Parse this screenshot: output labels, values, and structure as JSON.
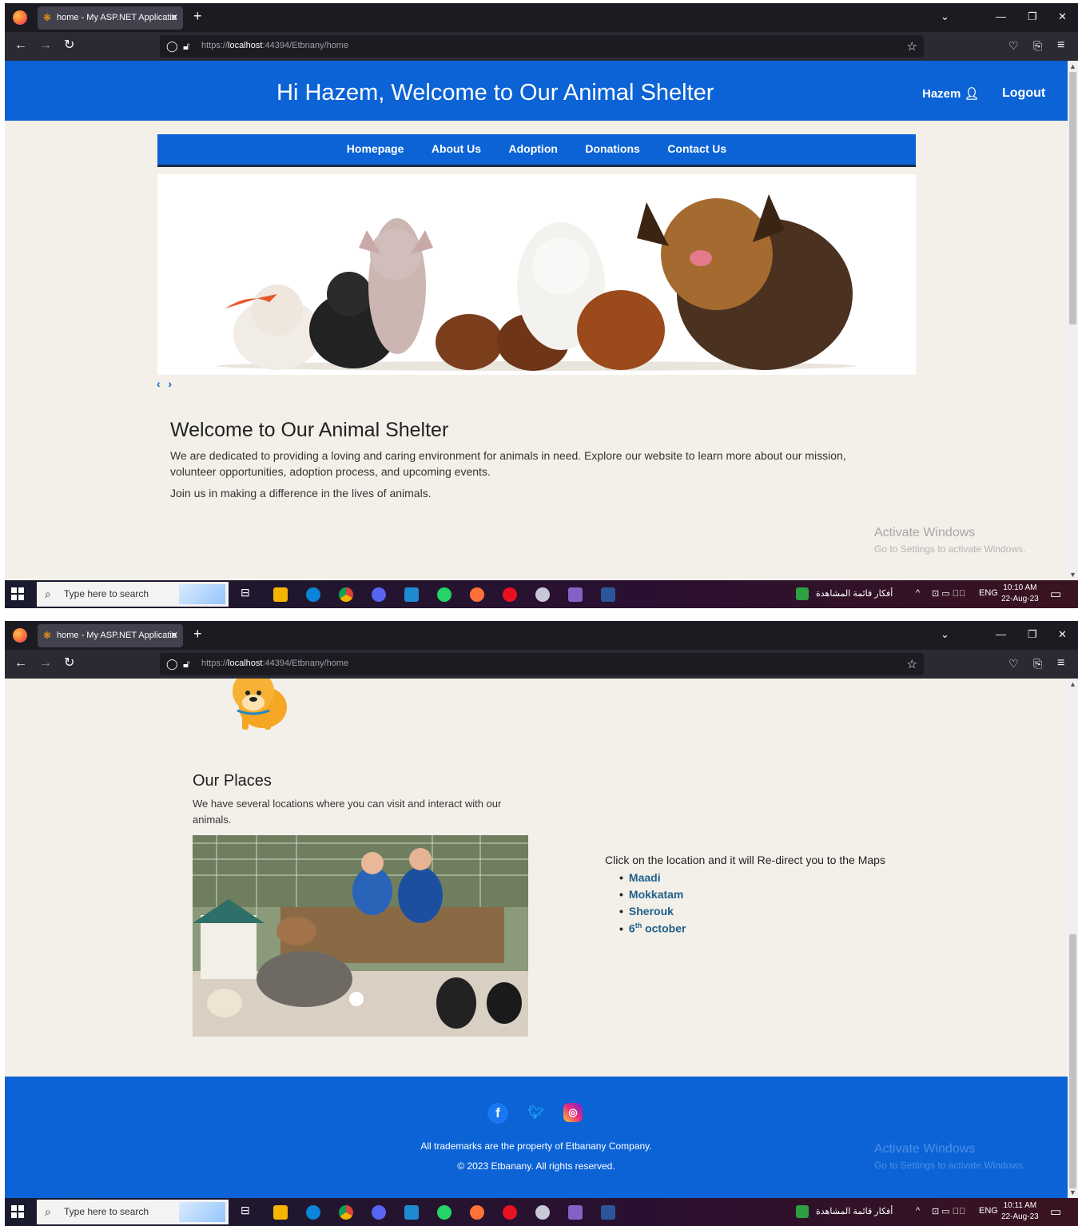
{
  "browser": {
    "tab_title": "home - My ASP.NET Applicatio",
    "new_tab": "+",
    "url_scheme": "https://",
    "url_host": "localhost",
    "url_rest": ":44394/Etbnany/home"
  },
  "site": {
    "header_title": "Hi Hazem, Welcome to Our Animal Shelter",
    "user_name": "Hazem",
    "logout_label": "Logout",
    "nav": [
      "Homepage",
      "About Us",
      "Adoption",
      "Donations",
      "Contact Us"
    ],
    "carousel_controls": "‹ ›",
    "welcome_title": "Welcome to Our Animal Shelter",
    "welcome_text": "We are dedicated to providing a loving and caring environment for animals in need. Explore our website to learn more about our mission, volunteer opportunities, adoption process, and upcoming events.",
    "join_text": "Join us in making a difference in the lives of animals.",
    "places_title": "Our Places",
    "places_text": "We have several locations where you can visit and interact with our animals.",
    "locations_intro": "Click on the location and it will Re-direct you to the Maps",
    "locations": [
      "Maadi",
      "Mokkatam",
      "Sherouk"
    ],
    "location_last_num": "6",
    "location_last_sup": "th",
    "location_last_word": "october",
    "footer_trademark": "All trademarks are the property of Etbanany Company.",
    "footer_copyright": "© 2023 Etbanany. All rights reserved."
  },
  "watermark": {
    "title": "Activate Windows",
    "subtitle": "Go to Settings to activate Windows."
  },
  "taskbar": {
    "search_placeholder": "Type here to search",
    "tray_arabic": "أفكار قائمة المشاهدة",
    "lang": "ENG",
    "shot1_time": "10:10 AM",
    "shot2_time": "10:11 AM",
    "date": "22-Aug-23"
  },
  "icons": [
    "firefox-icon",
    "shield-icon",
    "lock-icon",
    "star-icon",
    "pocket-icon",
    "extensions-icon",
    "menu-icon",
    "user-icon",
    "facebook-icon",
    "twitter-icon",
    "instagram-icon",
    "windows-icon",
    "search-icon"
  ],
  "colors": {
    "brand_blue": "#0b63d6",
    "page_bg": "#f2f0e8",
    "link": "#1f5f8b"
  }
}
